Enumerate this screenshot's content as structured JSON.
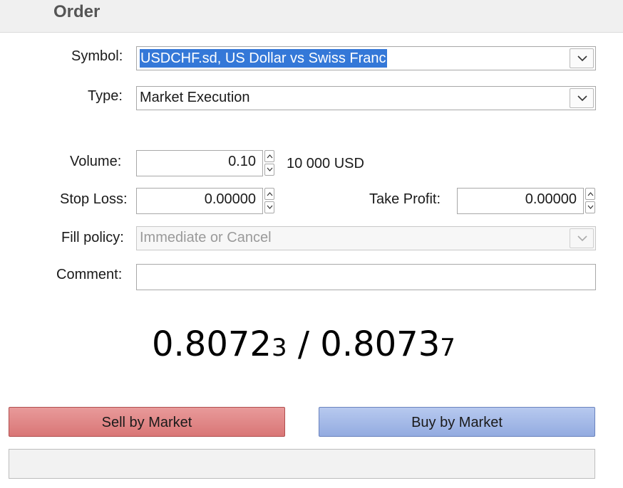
{
  "window": {
    "title": "Order"
  },
  "form": {
    "symbol": {
      "label": "Symbol:",
      "value": "USDCHF.sd, US Dollar vs Swiss Franc"
    },
    "type": {
      "label": "Type:",
      "value": "Market Execution"
    },
    "volume": {
      "label": "Volume:",
      "value": "0.10",
      "equivalent": "10 000 USD"
    },
    "stop_loss": {
      "label": "Stop Loss:",
      "value": "0.00000"
    },
    "take_profit": {
      "label": "Take Profit:",
      "value": "0.00000"
    },
    "fill_policy": {
      "label": "Fill policy:",
      "value": "Immediate or Cancel"
    },
    "comment": {
      "label": "Comment:",
      "value": ""
    }
  },
  "quote": {
    "bid_main": "0.8072",
    "bid_small": "3",
    "separator": "/",
    "ask_main": "0.8073",
    "ask_small": "7"
  },
  "actions": {
    "sell_label": "Sell by Market",
    "buy_label": "Buy by Market"
  },
  "status": {
    "text": ""
  },
  "icons": {
    "dropdown": "chevron-down-icon",
    "spin_up": "chevron-up-icon",
    "spin_down": "chevron-down-icon"
  },
  "colors": {
    "selection": "#3478d8",
    "sell_button": "#d97676",
    "buy_button": "#93abe0"
  }
}
